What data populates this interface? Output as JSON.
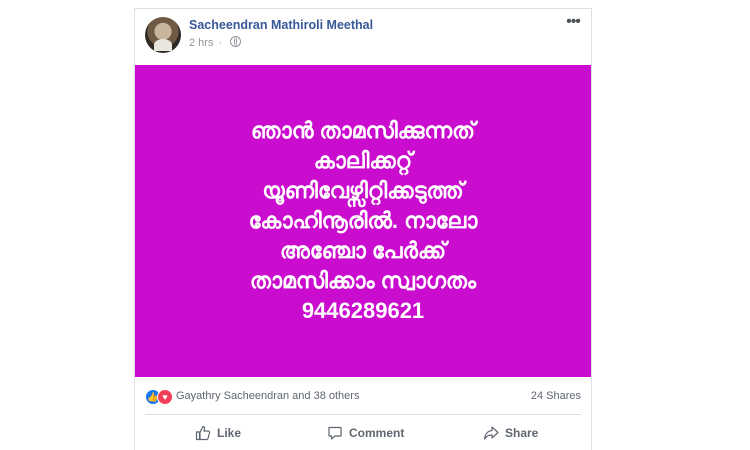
{
  "post": {
    "author": "Sacheendran Mathiroli Meethal",
    "time": "2 hrs",
    "image_text_lines": [
      "ഞാൻ താമസിക്കുന്നത്",
      "കാലിക്കറ്റ്",
      "യൂണിവേഴ്സിറ്റിക്കടുത്ത്",
      "കോഹിനൂരിൽ. നാലോ",
      "അഞ്ചോ പേർക്ക്",
      "താമസിക്കാം സ്വാഗതം",
      "9446289621"
    ],
    "background_color": "#c90ccd"
  },
  "reactions": {
    "names": "Gayathry Sacheendran and 38 others",
    "shares": "24 Shares"
  },
  "actions": {
    "like": "Like",
    "comment": "Comment",
    "share": "Share"
  }
}
